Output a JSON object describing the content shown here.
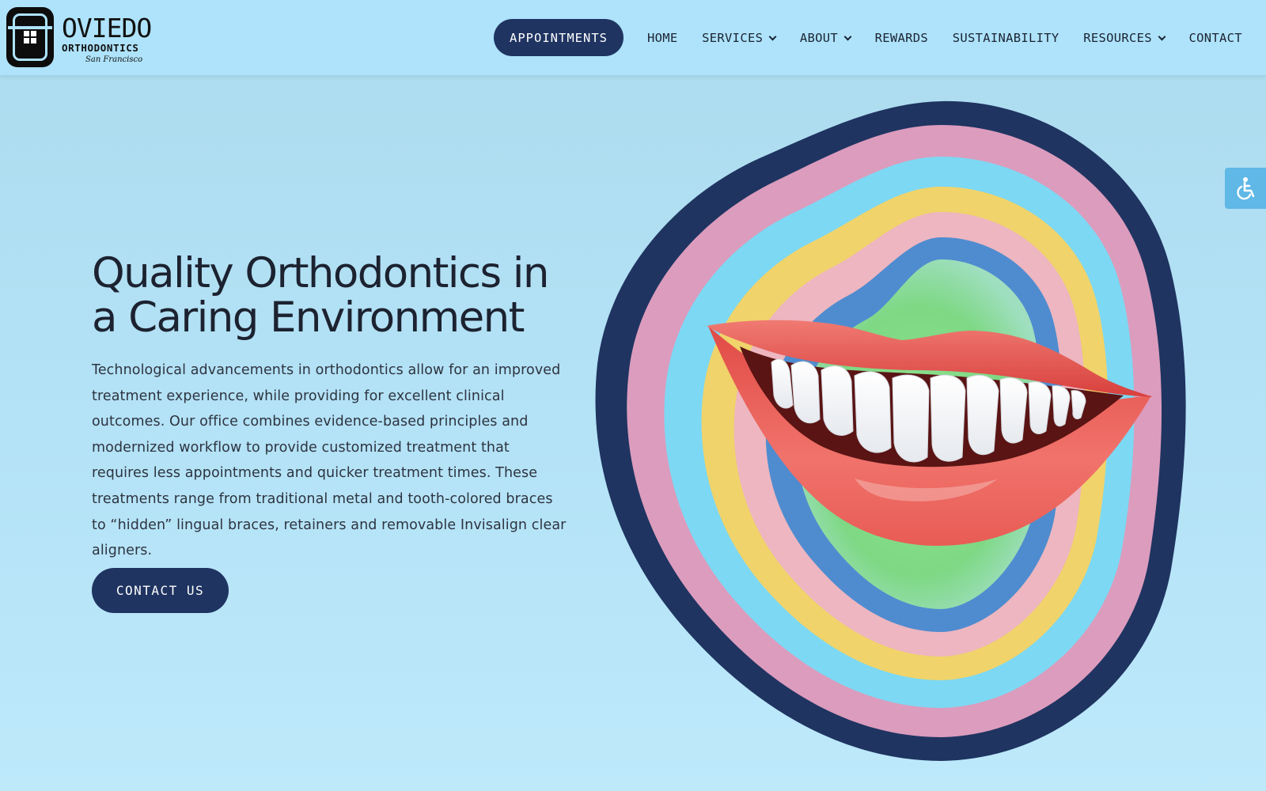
{
  "brand": {
    "name": "OVIEDO",
    "subtitle": "ORTHODONTICS",
    "city": "San Francisco"
  },
  "header": {
    "cta_label": "APPOINTMENTS",
    "nav": [
      {
        "label": "HOME",
        "dropdown": false
      },
      {
        "label": "SERVICES",
        "dropdown": true
      },
      {
        "label": "ABOUT",
        "dropdown": true
      },
      {
        "label": "REWARDS",
        "dropdown": false
      },
      {
        "label": "SUSTAINABILITY",
        "dropdown": false
      },
      {
        "label": "RESOURCES",
        "dropdown": true
      },
      {
        "label": "CONTACT",
        "dropdown": false
      }
    ]
  },
  "hero": {
    "title_line1": "Quality Orthodontics in",
    "title_line2": "a Caring Environment",
    "body": "Technological advancements in orthodontics allow for an improved treatment experience, while providing for excellent clinical outcomes. Our office combines evidence-based principles and modernized workflow to provide customized treatment that requires less appointments and quicker treatment times. These treatments range from traditional metal and tooth-colored braces to “hidden” lingual braces, retainers and removable Invisalign clear aligners.",
    "cta_label": "CONTACT US"
  },
  "icons": {
    "accessibility": "wheelchair-icon",
    "chevron": "chevron-down-icon"
  },
  "colors": {
    "background": "#b4e2f6",
    "header_bg": "#aee3fb",
    "button_bg": "#1f3461",
    "button_text": "#ffffff",
    "text_dark": "#1c2230",
    "ring_navy": "#1f3461",
    "ring_pink": "#dc9cbd",
    "ring_sky": "#7dd8f3",
    "ring_yellow": "#f0d36a",
    "ring_rose": "#edb6c0",
    "ring_blue": "#4f8ccf",
    "center_green": "#7ed884",
    "lips": "#e8554f",
    "accessibility_bg": "#5fb8e6"
  }
}
